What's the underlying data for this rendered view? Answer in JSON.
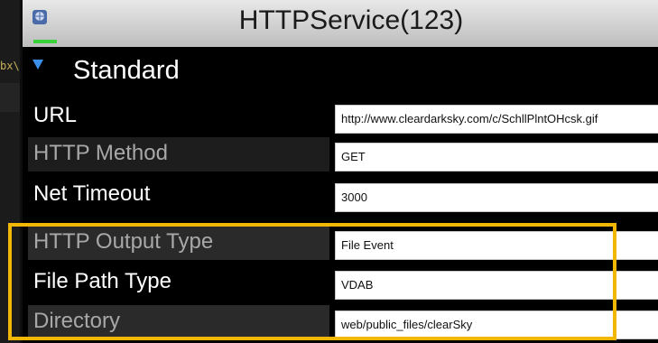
{
  "window": {
    "title": "HTTPService(123)",
    "icon": "app-globe-icon"
  },
  "background": {
    "stub_text": "bx\\"
  },
  "section": {
    "label": "Standard",
    "icon": "triangle-down-icon",
    "icon_color": "#3a8fe8"
  },
  "fields": [
    {
      "label": "URL",
      "value": "http://www.cleardarksky.com/c/SchllPlntOHcsk.gif"
    },
    {
      "label": "HTTP Method",
      "value": "GET"
    },
    {
      "label": "Net Timeout",
      "value": "3000"
    },
    {
      "label": "HTTP Output Type",
      "value": "File Event"
    },
    {
      "label": "File Path Type",
      "value": "VDAB"
    },
    {
      "label": "Directory",
      "value": "web/public_files/clearSky"
    }
  ],
  "colors": {
    "highlight": "#f2b705",
    "field_underline": "#d8c200"
  }
}
